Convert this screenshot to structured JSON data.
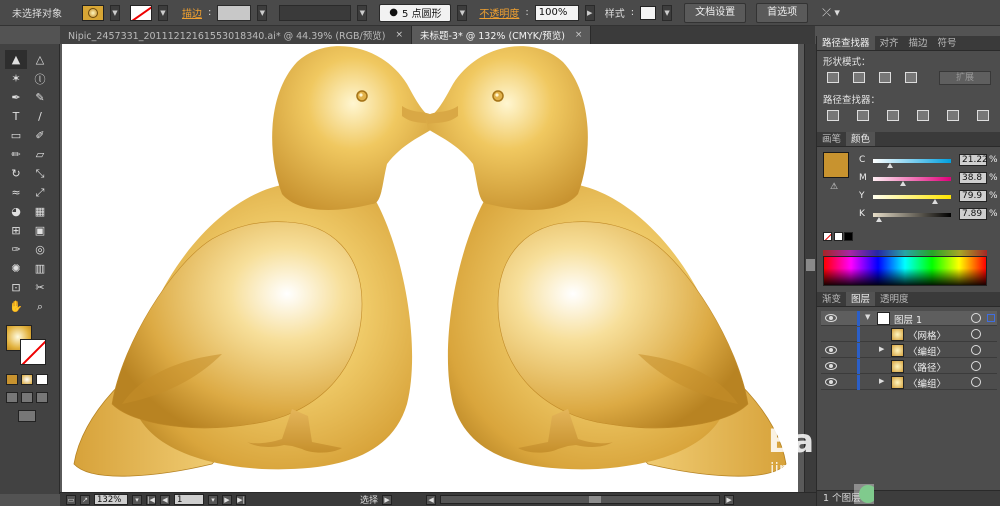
{
  "control_bar": {
    "selection_status": "未选择对象",
    "stroke_label": "描边",
    "brush_label": "5 点圆形",
    "opacity_label": "不透明度",
    "opacity_value": "100%",
    "style_label": "样式",
    "doc_setup_button": "文档设置",
    "preferences_button": "首选项"
  },
  "tabs": [
    {
      "label": "Nipic_2457331_20111212161553018340.ai* @ 44.39% (RGB/预览)",
      "close": "×"
    },
    {
      "label": "未标题-3* @ 132% (CMYK/预览)",
      "close": "×"
    }
  ],
  "tools": {
    "items": [
      "selection-tool",
      "direct-selection-tool",
      "magic-wand-tool",
      "lasso-tool",
      "pen-tool",
      "curvature-tool",
      "type-tool",
      "line-tool",
      "rectangle-tool",
      "paintbrush-tool",
      "pencil-tool",
      "eraser-tool",
      "rotate-tool",
      "scale-tool",
      "width-tool",
      "free-transform-tool",
      "shape-builder-tool",
      "perspective-tool",
      "mesh-tool",
      "gradient-tool",
      "eyedropper-tool",
      "blend-tool",
      "symbol-sprayer-tool",
      "column-graph-tool",
      "artboard-tool",
      "slice-tool",
      "hand-tool",
      "zoom-tool"
    ],
    "glyphs": [
      "▲",
      "△",
      "✶",
      "ⓛ",
      "✒",
      "✎",
      "T",
      "/",
      "▭",
      "✐",
      "✏",
      "▱",
      "↻",
      "⤡",
      "≈",
      "⤢",
      "◕",
      "▦",
      "⊞",
      "▣",
      "✑",
      "◎",
      "✺",
      "▥",
      "⊡",
      "✂",
      "✋",
      "⌕"
    ]
  },
  "status_bar": {
    "zoom": "132%",
    "page": "1",
    "mode": "选择"
  },
  "pathfinder_panel": {
    "tabs": [
      "路径查找器",
      "对齐",
      "描边",
      "符号"
    ],
    "shape_modes_label": "形状模式：",
    "expand_button": "扩展",
    "pathfinders_label": "路径查找器："
  },
  "color_panel": {
    "tabs": [
      "画笔",
      "颜色"
    ],
    "swatch_color": "#c8932f",
    "sliders": [
      {
        "label": "C",
        "value": "21.22",
        "fraction": 0.2122
      },
      {
        "label": "M",
        "value": "38.8",
        "fraction": 0.388
      },
      {
        "label": "Y",
        "value": "79.9",
        "fraction": 0.799
      },
      {
        "label": "K",
        "value": "7.89",
        "fraction": 0.0789
      }
    ],
    "percent": "%"
  },
  "layers_panel": {
    "tabs": [
      "渐变",
      "图层",
      "透明度"
    ],
    "rows": [
      {
        "name": "图层 1",
        "eye": true,
        "expanded": true,
        "indent": 0
      },
      {
        "name": "〈网格〉",
        "eye": false,
        "expanded": false,
        "indent": 1
      },
      {
        "name": "〈编组〉",
        "eye": true,
        "expanded": false,
        "indent": 1
      },
      {
        "name": "〈路径〉",
        "eye": true,
        "expanded": false,
        "indent": 1
      },
      {
        "name": "〈编组〉",
        "eye": true,
        "expanded": false,
        "indent": 1
      }
    ],
    "footer": "1 个图层"
  },
  "watermark": {
    "text_big": "Ba",
    "text_small": "jing"
  },
  "colors": {
    "bird_light": "#fff8d8",
    "bird_mid": "#e8bb4a",
    "bird_dark": "#b07d1c",
    "accent_orange": "#f0a030"
  }
}
